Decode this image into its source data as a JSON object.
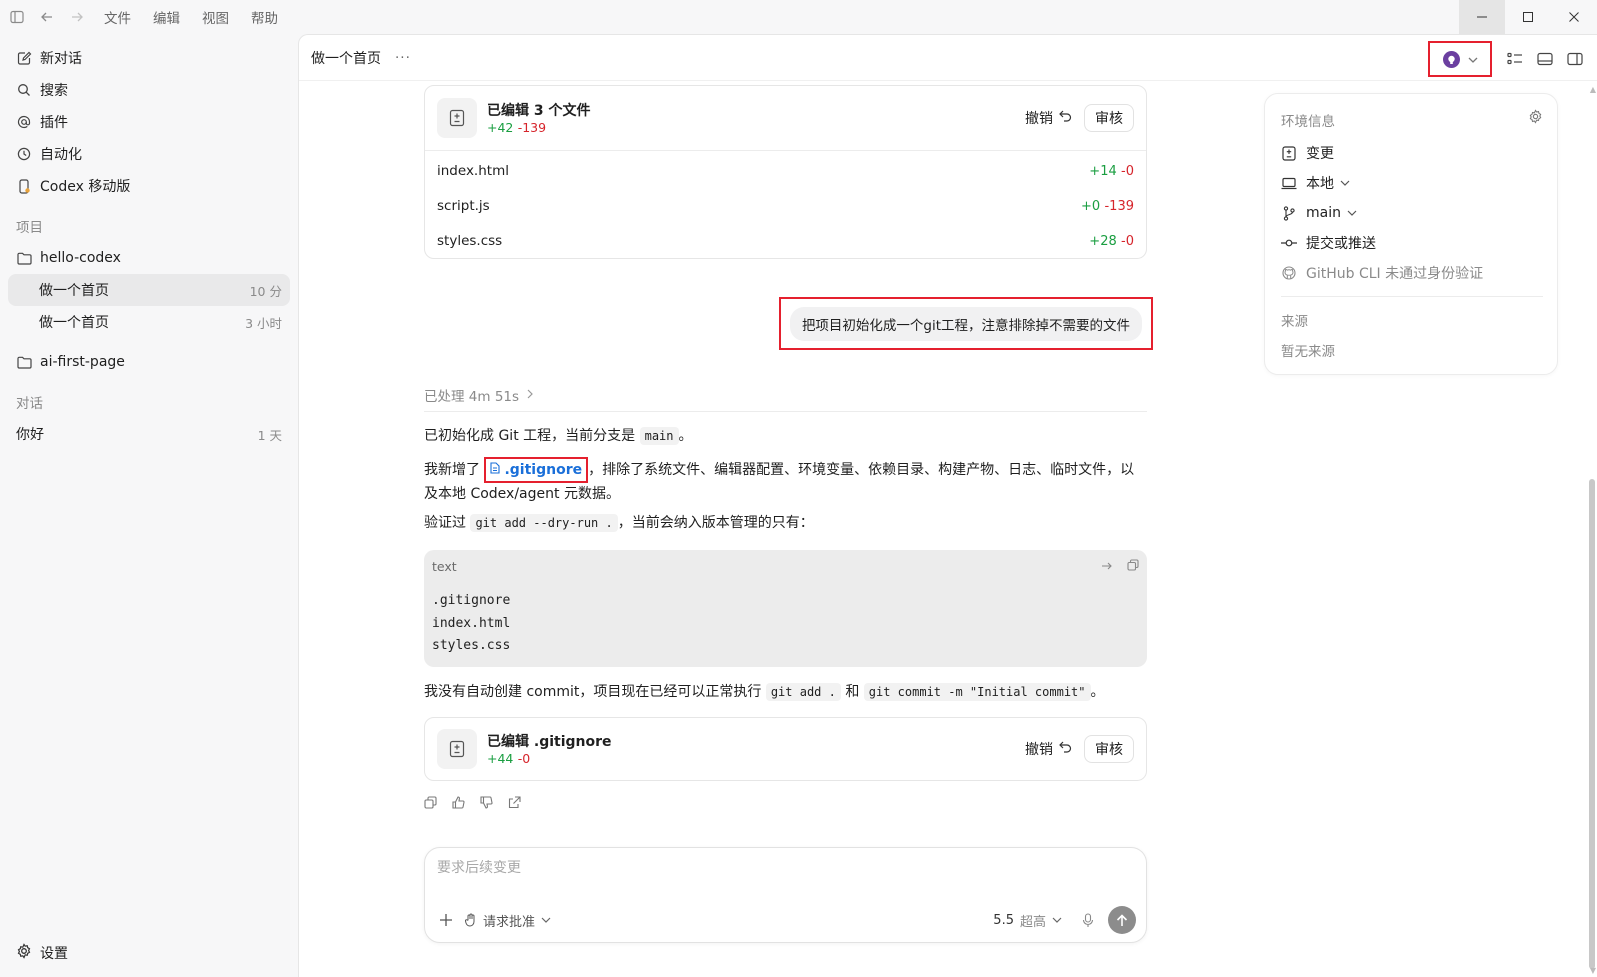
{
  "menu": [
    "文件",
    "编辑",
    "视图",
    "帮助"
  ],
  "sidebar": {
    "nav": [
      {
        "label": "新对话",
        "icon": "edit-icon"
      },
      {
        "label": "搜索",
        "icon": "search-icon"
      },
      {
        "label": "插件",
        "icon": "at-icon"
      },
      {
        "label": "自动化",
        "icon": "clock-icon"
      },
      {
        "label": "Codex 移动版",
        "icon": "mobile-icon"
      }
    ],
    "projects_label": "项目",
    "projects": [
      {
        "name": "hello-codex",
        "conversations": [
          {
            "title": "做一个首页",
            "time": "10 分"
          },
          {
            "title": "做一个首页",
            "time": "3 小时"
          }
        ]
      },
      {
        "name": "ai-first-page",
        "conversations": []
      }
    ],
    "chats_label": "对话",
    "chats": [
      {
        "title": "你好",
        "time": "1 天"
      }
    ],
    "settings_label": "设置"
  },
  "header": {
    "title": "做一个首页",
    "more": "···"
  },
  "edit_card_1": {
    "title": "已编辑 3 个文件",
    "added": "+42",
    "removed": "-139",
    "undo": "撤销",
    "review": "审核",
    "files": [
      {
        "name": "index.html",
        "added": "+14",
        "removed": "-0"
      },
      {
        "name": "script.js",
        "added": "+0",
        "removed": "-139"
      },
      {
        "name": "styles.css",
        "added": "+28",
        "removed": "-0"
      }
    ]
  },
  "user_message": "把项目初始化成一个git工程，注意排除掉不需要的文件",
  "processed": "已处理 4m 51s",
  "assistant": {
    "p1_a": "已初始化成 Git 工程，当前分支是",
    "p1_code": "main",
    "p1_b": "。",
    "p2_a": "我新增了",
    "p2_file": ".gitignore",
    "p2_b": "，排除了系统文件、编辑器配置、环境变量、依赖目录、构建产物、日志、临时文件，以及本地 Codex/agent 元数据。",
    "p3_a": "验证过",
    "p3_code": "git add --dry-run .",
    "p3_b": "，当前会纳入版本管理的只有：",
    "code_lang": "text",
    "code_lines": [
      ".gitignore",
      "index.html",
      "styles.css"
    ],
    "p4_a": "我没有自动创建 commit，项目现在已经可以正常执行",
    "p4_code1": "git add .",
    "p4_mid": "和",
    "p4_code2": "git commit -m \"Initial commit\"",
    "p4_b": "。"
  },
  "edit_card_2": {
    "title": "已编辑 .gitignore",
    "added": "+44",
    "removed": "-0",
    "undo": "撤销",
    "review": "审核"
  },
  "composer": {
    "placeholder": "要求后续变更",
    "approval": "请求批准",
    "model": "5.5",
    "level": "超高"
  },
  "env_panel": {
    "title": "环境信息",
    "rows": [
      {
        "label": "变更",
        "icon": "diff-icon"
      },
      {
        "label": "本地",
        "icon": "laptop-icon"
      },
      {
        "label": "main",
        "icon": "branch-icon"
      },
      {
        "label": "提交或推送",
        "icon": "commit-icon"
      },
      {
        "label": "GitHub CLI 未通过身份验证",
        "icon": "github-icon"
      }
    ],
    "source_label": "来源",
    "source_empty": "暂无来源"
  }
}
